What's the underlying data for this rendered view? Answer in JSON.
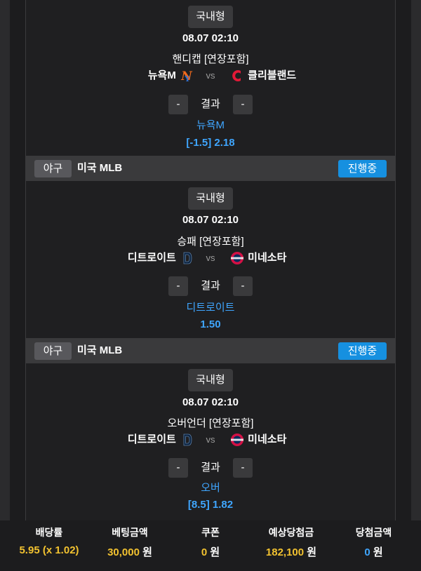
{
  "matches": [
    {
      "type": "국내형",
      "datetime": "08.07 02:10",
      "market": "핸디캡 [연장포함]",
      "home": "뉴욕M",
      "vs": "vs",
      "away": "클리블랜드",
      "minus": "-",
      "result_label": "결과",
      "pick": "뉴욕M",
      "odds": "[-1.5] 2.18"
    },
    {
      "league": {
        "sport": "야구",
        "name": "미국 MLB",
        "status": "진행중"
      },
      "type": "국내형",
      "datetime": "08.07 02:10",
      "market": "승패 [연장포함]",
      "home": "디트로이트",
      "vs": "vs",
      "away": "미네소타",
      "minus": "-",
      "result_label": "결과",
      "pick": "디트로이트",
      "odds": "1.50"
    },
    {
      "league": {
        "sport": "야구",
        "name": "미국 MLB",
        "status": "진행중"
      },
      "type": "국내형",
      "datetime": "08.07 02:10",
      "market": "오버언더 [연장포함]",
      "home": "디트로이트",
      "vs": "vs",
      "away": "미네소타",
      "minus": "-",
      "result_label": "결과",
      "pick": "오버",
      "odds": "[8.5] 1.82"
    }
  ],
  "summary": {
    "odds_label": "배당률",
    "odds_value": "5.95 (x 1.02)",
    "bet_label": "베팅금액",
    "bet_value": "30,000",
    "coupon_label": "쿠폰",
    "coupon_value": "0",
    "expected_label": "예상당첨금",
    "expected_value": "182,100",
    "won_label": "당첨금액",
    "won_value": "0",
    "unit": "원"
  },
  "colors": {
    "accent_blue": "#3fa6ff",
    "status_blue": "#1690e0",
    "yellow": "#f2c230"
  },
  "icons": [
    "mets-logo-icon",
    "guardians-logo-icon",
    "tigers-logo-icon",
    "twins-logo-icon"
  ]
}
